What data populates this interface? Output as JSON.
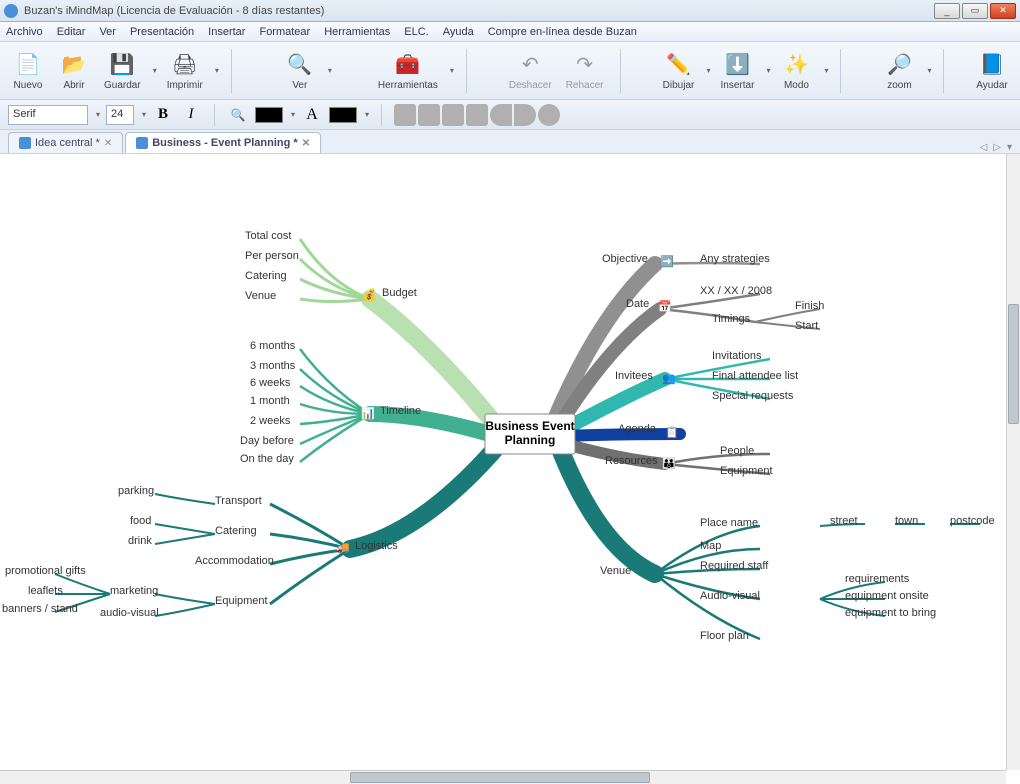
{
  "window": {
    "title": "Buzan's iMindMap (Licencia de Evaluación -   8 días restantes)"
  },
  "menu": {
    "items": [
      "Archivo",
      "Editar",
      "Ver",
      "Presentación",
      "Insertar",
      "Formatear",
      "Herramientas",
      "ELC.",
      "Ayuda",
      "Compre en-línea desde Buzan"
    ]
  },
  "toolbar": {
    "nuevo": "Nuevo",
    "abrir": "Abrir",
    "guardar": "Guardar",
    "imprimir": "Imprimir",
    "ver": "Ver",
    "herramientas": "Herramientas",
    "deshacer": "Deshacer",
    "rehacer": "Rehacer",
    "dibujar": "Dibujar",
    "insertar": "Insertar",
    "modo": "Modo",
    "zoom": "zoom",
    "ayudar": "Ayudar"
  },
  "format": {
    "font": "Serif",
    "size": "24"
  },
  "tabs": {
    "t1": "Idea central *",
    "t2": "Business - Event Planning *"
  },
  "mindmap": {
    "central": "Business Event Planning",
    "branches": {
      "budget": {
        "label": "Budget",
        "items": [
          "Total cost",
          "Per person",
          "Catering",
          "Venue"
        ]
      },
      "timeline": {
        "label": "Timeline",
        "items": [
          "6 months",
          "3 months",
          "6 weeks",
          "1 month",
          "2 weeks",
          "Day before",
          "On the day"
        ]
      },
      "logistics": {
        "label": "Logistics",
        "items": [
          "Transport",
          "Catering",
          "Accommodation",
          "Equipment"
        ],
        "transport_sub": [
          "parking",
          "food",
          "drink"
        ],
        "equipment_sub": [
          "marketing",
          "audio-visual"
        ],
        "marketing_sub": [
          "promotional gifts",
          "leaflets",
          "banners / stand"
        ]
      },
      "objective": {
        "label": "Objective",
        "items": [
          "Any strategies"
        ]
      },
      "date": {
        "label": "Date",
        "items": [
          "XX / XX / 2008",
          "Timings"
        ],
        "timings_sub": [
          "Finish",
          "Start"
        ]
      },
      "invitees": {
        "label": "Invitees",
        "items": [
          "Invitations",
          "Final attendee list",
          "Special requests"
        ]
      },
      "agenda": {
        "label": "Agenda"
      },
      "resources": {
        "label": "Resources",
        "items": [
          "People",
          "Equipment"
        ]
      },
      "venue": {
        "label": "Venue",
        "items": [
          "Place name",
          "Map",
          "Required staff",
          "Audio-visual",
          "Floor plan"
        ],
        "place_sub": [
          "street",
          "town",
          "postcode"
        ],
        "audio_sub": [
          "requirements",
          "equipment onsite",
          "equipment to bring"
        ]
      }
    }
  }
}
